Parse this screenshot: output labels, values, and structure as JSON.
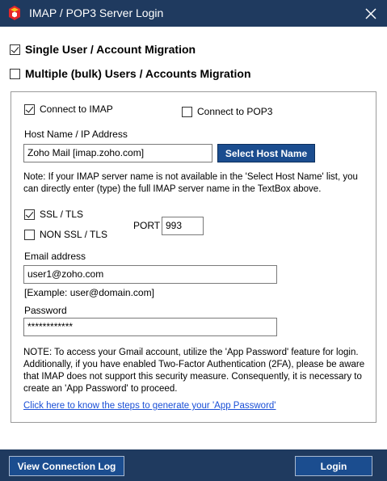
{
  "window": {
    "title": "IMAP / POP3 Server Login",
    "accent": "#1f3a5f",
    "button_blue": "#1b4d8f"
  },
  "icons": {
    "app": "app-logo-icon",
    "close": "close-icon"
  },
  "migration": {
    "single_label": "Single User / Account Migration",
    "single_checked": true,
    "multiple_label": "Multiple (bulk) Users / Accounts Migration",
    "multiple_checked": false
  },
  "connection": {
    "imap_label": "Connect to IMAP",
    "imap_checked": true,
    "pop3_label": "Connect to POP3",
    "pop3_checked": false
  },
  "host": {
    "label": "Host Name / IP Address",
    "value": "Zoho Mail [imap.zoho.com]",
    "select_button": "Select Host Name",
    "note": "Note: If your IMAP server name is not available in the 'Select Host Name' list, you can directly enter (type) the full IMAP server name in the TextBox above."
  },
  "security": {
    "ssl_label": "SSL / TLS",
    "ssl_checked": true,
    "nonssl_label": "NON SSL / TLS",
    "nonssl_checked": false,
    "port_label": "PORT",
    "port_value": "993"
  },
  "email": {
    "label": "Email address",
    "value": "user1@zoho.com",
    "example": "[Example: user@domain.com]"
  },
  "password": {
    "label": "Password",
    "value": "************"
  },
  "notice": {
    "text": "NOTE: To access your Gmail account, utilize the 'App Password' feature for login. Additionally, if you have enabled Two-Factor Authentication (2FA), please be aware that IMAP does not support this security measure. Consequently, it is necessary to create an 'App Password' to proceed.",
    "link": "Click here to know the steps to generate your 'App Password'"
  },
  "footer": {
    "log_button": "View Connection Log",
    "login_button": "Login"
  }
}
